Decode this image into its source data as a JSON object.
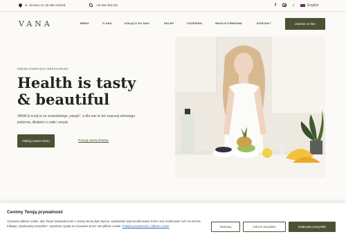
{
  "topbar": {
    "address": "ul. Hemara 13, 80-280 Gdańsk",
    "phone": "+48 666 353 522",
    "social_icons": [
      "facebook-icon",
      "instagram-icon",
      "tiktok-icon"
    ],
    "language": "English"
  },
  "brand": {
    "logo": "VANA"
  },
  "nav": {
    "items": [
      "MENU",
      "O NAS",
      "DOŁĄCZ DO NAS",
      "SKLEP",
      "CATERING",
      "WIGILIA FIRMOWA",
      "KONTAKT"
    ],
    "cta": "Zamów on-line"
  },
  "hero": {
    "eyebrow": "FRESH EVERYDAY RESTAURANT",
    "title_line1": "Health is tasty",
    "title_line2": "& beautiful",
    "description": "VANA [v'a:na] to ze szwedzkiego „nawyk”, a dla nas to też zwyczaj zdrowego jedzenia, dbałości o ciało i umysł.",
    "primary_button": "Odkryj nasze menu",
    "secondary_link": "Poznaj naszą historię"
  },
  "cookie": {
    "title": "Cenimy Twoją prywatność",
    "text": "Używamy plików cookie, aby Twoje doświadczenie z naszą stroną było lepsze, wyświetlać spersonalizowane treści oraz analizować ruch na stronie. Klikając „Zaakceptuj wszystkie”, wyrażasz zgodę na używanie przez nas plików cookie.",
    "policy_link": "Polityka prywatności i plików cookie",
    "buttons": {
      "customize": "Dostosuj",
      "reject": "Odrzuć wszystkie",
      "accept": "Zaakceptuj wszystkie"
    }
  },
  "colors": {
    "accent": "#4a5233",
    "background": "#fbfaf6",
    "text": "#25261f"
  }
}
